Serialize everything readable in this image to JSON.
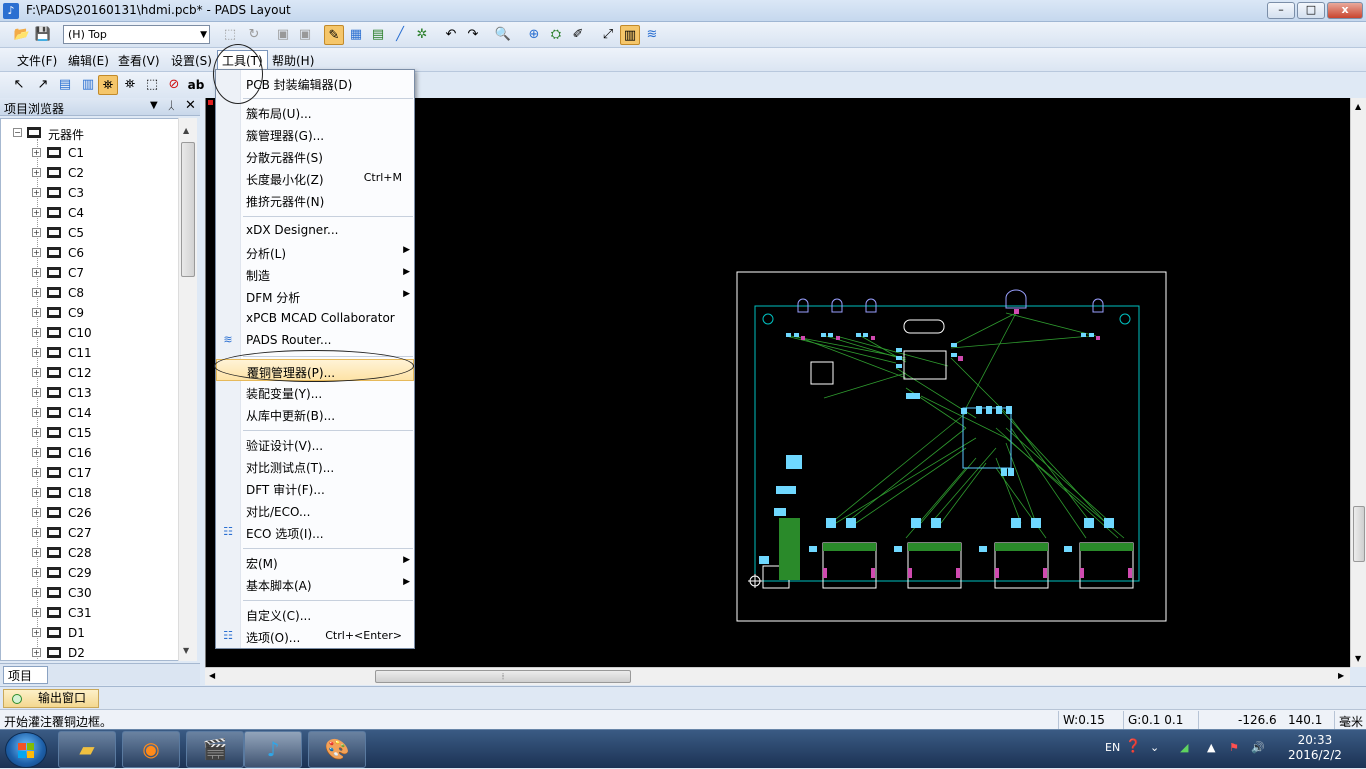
{
  "window": {
    "title": "F:\\PADS\\20160131\\hdmi.pcb* - PADS Layout",
    "minimize": "–",
    "maximize": "□",
    "close": "x"
  },
  "toolbar": {
    "layer_value": "(H) Top"
  },
  "menubar": {
    "items": [
      {
        "label": "文件(F)"
      },
      {
        "label": "编辑(E)"
      },
      {
        "label": "查看(V)"
      },
      {
        "label": "设置(S)"
      },
      {
        "label": "工具(T)"
      },
      {
        "label": "帮助(H)"
      }
    ]
  },
  "project_browser": {
    "title": "项目浏览器",
    "root": "元器件",
    "items": [
      "C1",
      "C2",
      "C3",
      "C4",
      "C5",
      "C6",
      "C7",
      "C8",
      "C9",
      "C10",
      "C11",
      "C12",
      "C13",
      "C14",
      "C15",
      "C16",
      "C17",
      "C18",
      "C26",
      "C27",
      "C28",
      "C29",
      "C30",
      "C31",
      "D1",
      "D2"
    ],
    "tab": "项目"
  },
  "tools_menu": {
    "items": [
      {
        "label": "PCB 封装编辑器(D)",
        "shortcut": "",
        "submenu": false
      },
      {
        "label": "簇布局(U)...",
        "shortcut": "",
        "submenu": false
      },
      {
        "label": "簇管理器(G)...",
        "shortcut": "",
        "submenu": false
      },
      {
        "label": "分散元器件(S)",
        "shortcut": "",
        "submenu": false
      },
      {
        "label": "长度最小化(Z)",
        "shortcut": "Ctrl+M",
        "submenu": false
      },
      {
        "label": "推挤元器件(N)",
        "shortcut": "",
        "submenu": false
      },
      {
        "label": "xDX Designer...",
        "shortcut": "",
        "submenu": false
      },
      {
        "label": "分析(L)",
        "shortcut": "",
        "submenu": true
      },
      {
        "label": "制造",
        "shortcut": "",
        "submenu": true
      },
      {
        "label": "DFM 分析",
        "shortcut": "",
        "submenu": true
      },
      {
        "label": "xPCB MCAD Collaborator",
        "shortcut": "",
        "submenu": false
      },
      {
        "label": "PADS Router...",
        "shortcut": "",
        "submenu": false
      },
      {
        "label": "覆铜管理器(P)...",
        "shortcut": "",
        "submenu": false
      },
      {
        "label": "装配变量(Y)...",
        "shortcut": "",
        "submenu": false
      },
      {
        "label": "从库中更新(B)...",
        "shortcut": "",
        "submenu": false
      },
      {
        "label": "验证设计(V)...",
        "shortcut": "",
        "submenu": false
      },
      {
        "label": "对比测试点(T)...",
        "shortcut": "",
        "submenu": false
      },
      {
        "label": "DFT 审计(F)...",
        "shortcut": "",
        "submenu": false
      },
      {
        "label": "对比/ECO...",
        "shortcut": "",
        "submenu": false
      },
      {
        "label": "ECO 选项(I)...",
        "shortcut": "",
        "submenu": false
      },
      {
        "label": "宏(M)",
        "shortcut": "",
        "submenu": true
      },
      {
        "label": "基本脚本(A)",
        "shortcut": "",
        "submenu": true
      },
      {
        "label": "自定义(C)...",
        "shortcut": "",
        "submenu": false
      },
      {
        "label": "选项(O)...",
        "shortcut": "Ctrl+<Enter>",
        "submenu": false
      }
    ]
  },
  "output": {
    "tab": "输出窗口"
  },
  "status": {
    "message": "开始灌注覆铜边框。",
    "width": "W:0.15",
    "grid": "G:0.1 0.1",
    "x": "-126.6",
    "y": "140.1",
    "unit": "毫米"
  },
  "tray": {
    "lang": "EN",
    "time": "20:33",
    "date": "2016/2/2"
  },
  "colors": {
    "canvas": "#000000",
    "board": "#ffffff",
    "outline": "#00c0c0",
    "trace": "#2f9c2f",
    "pad": "#d04ab0",
    "highlight": "#fde3a6"
  }
}
